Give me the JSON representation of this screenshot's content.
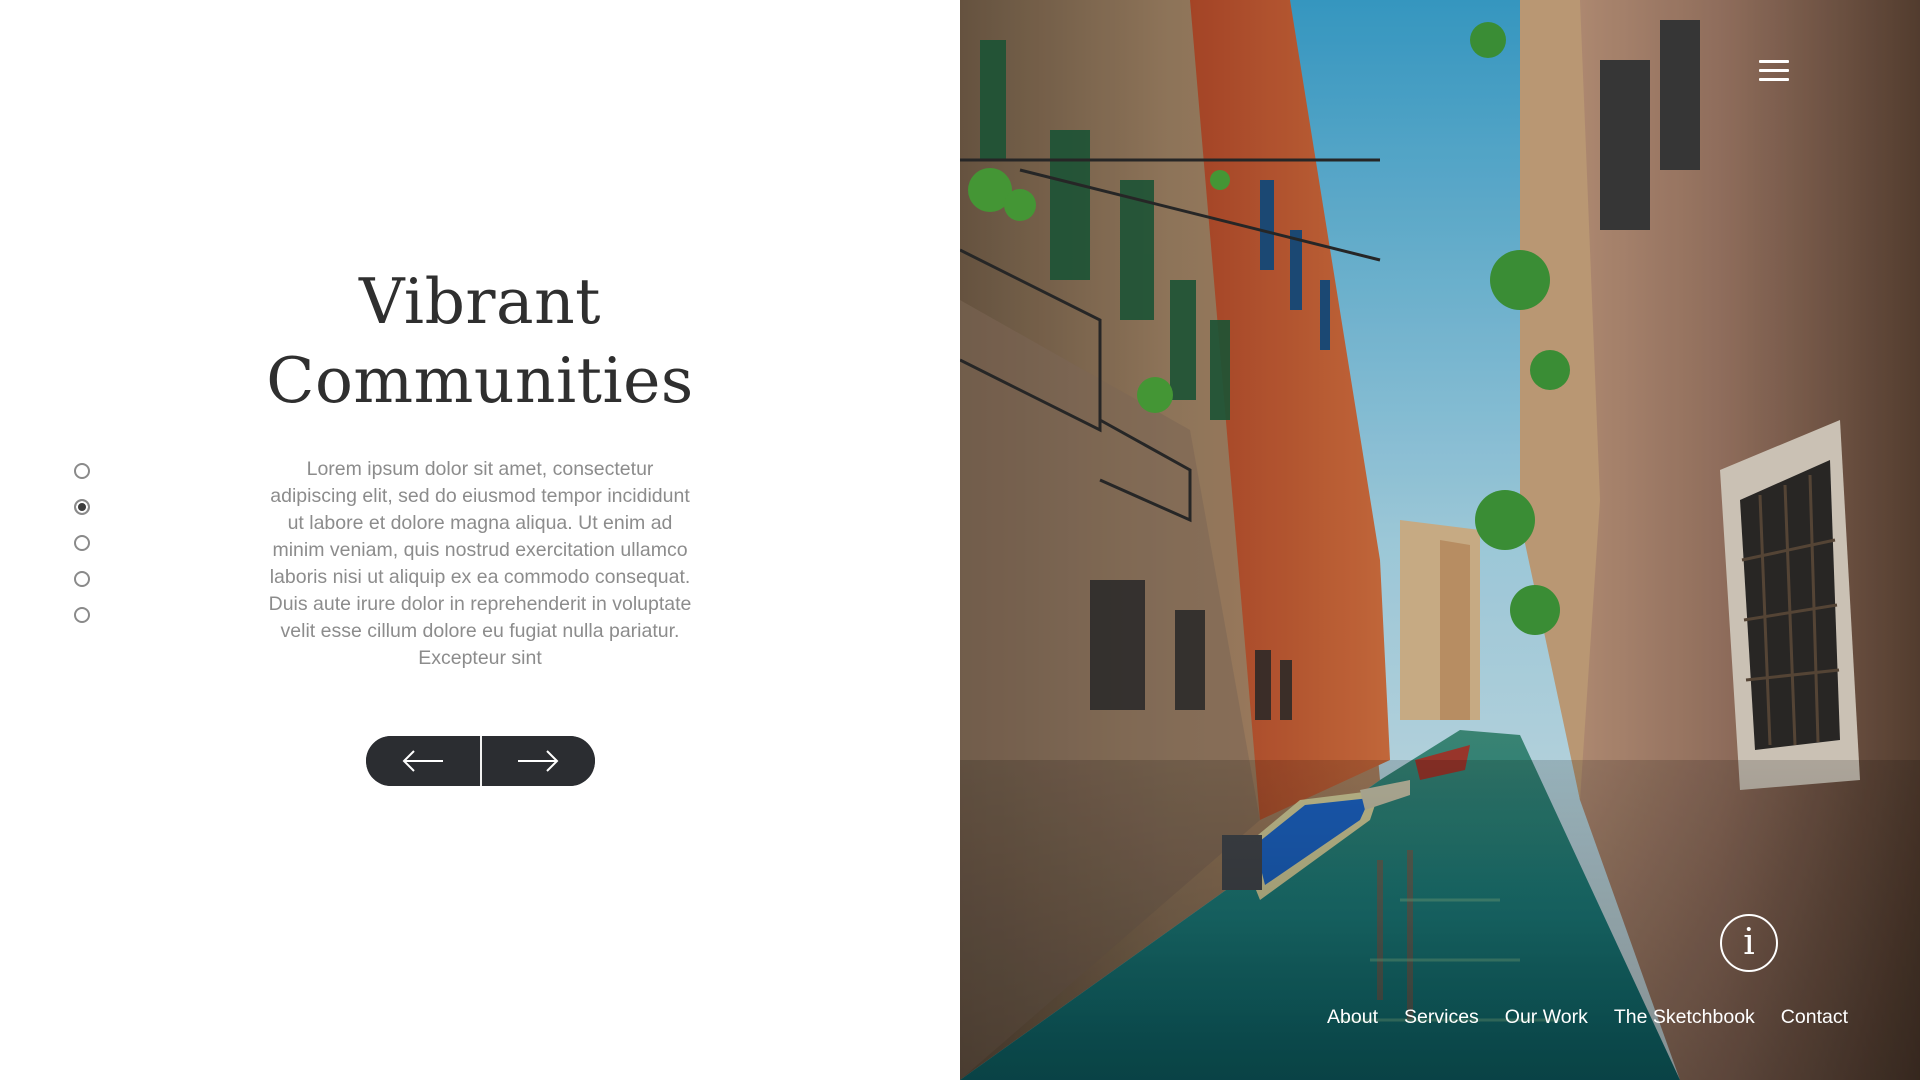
{
  "slide": {
    "title_line1": "Vibrant",
    "title_line2": "Communities",
    "body": "Lorem ipsum dolor sit amet, consectetur adipiscing elit, sed do eiusmod tempor incididunt ut labore et dolore magna aliqua. Ut enim ad minim veniam, quis nostrud exercitation ullamco laboris nisi ut aliquip ex ea commodo consequat. Duis aute irure dolor in reprehenderit in voluptate velit esse cillum dolore eu fugiat nulla pariatur. Excepteur sint"
  },
  "pager": {
    "count": 5,
    "active_index": 1
  },
  "controls": {
    "prev_icon": "arrow-left-icon",
    "next_icon": "arrow-right-icon",
    "menu_icon": "hamburger-menu-icon",
    "info_icon": "info-icon",
    "info_glyph": "i"
  },
  "nav": {
    "items": [
      "About",
      "Services",
      "Our Work",
      "The Sketchbook",
      "Contact"
    ]
  },
  "colors": {
    "title": "#2f2f2f",
    "body_text": "#8c8c8c",
    "button_bg": "#2b2d31",
    "pager_active": "#3d3d3d",
    "nav_text": "#ffffff"
  }
}
